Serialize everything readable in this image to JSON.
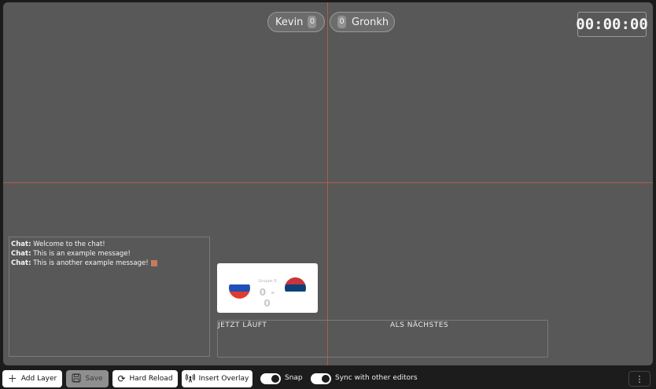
{
  "overlay": {
    "players": [
      {
        "name": "Kevin",
        "score": "0"
      },
      {
        "name": "Gronkh",
        "score": "0"
      }
    ],
    "timer": "00:00:00",
    "chat": [
      {
        "user": "Chat:",
        "message": " Welcome to the chat!"
      },
      {
        "user": "Chat:",
        "message": " This is an example message!"
      },
      {
        "user": "Chat:",
        "message": " This is another example message!"
      }
    ],
    "match": {
      "label": "Gruppe B",
      "score_home": "0",
      "score_away": "0",
      "home_flag": "slovenia-flag-icon",
      "away_flag": "serbia-flag-icon"
    },
    "schedule": {
      "now_label": "JETZT LÄUFT",
      "next_label": "ALS NÄCHSTES"
    }
  },
  "toolbar": {
    "add_layer": "Add Layer",
    "save": "Save",
    "hard_reload": "Hard Reload",
    "insert_overlay": "Insert Overlay",
    "snap": "Snap",
    "sync": "Sync with other editors",
    "more": "⋮"
  },
  "colors": {
    "canvas_bg": "#585858",
    "guide_line": "#c0603d",
    "toolbar_bg": "#1c1c1c"
  }
}
